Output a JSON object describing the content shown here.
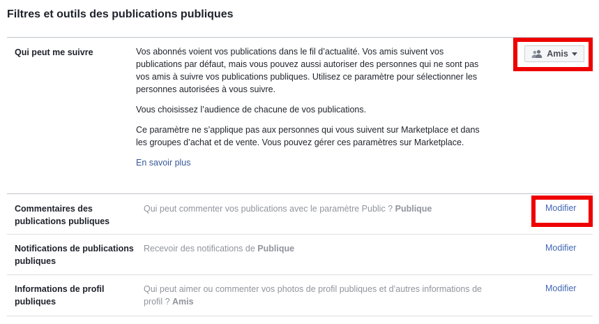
{
  "title": "Filtres et outils des publications publiques",
  "follow": {
    "label": "Qui peut me suivre",
    "paragraph1": "Vos abonnés voient vos publications dans le fil d’actualité. Vos amis suivent vos publications par défaut, mais vous pouvez aussi autoriser des personnes qui ne sont pas vos amis à suivre vos publications publiques. Utilisez ce paramètre pour sélectionner les personnes autorisées à vous suivre.",
    "paragraph2": "Vous choisissez l’audience de chacune de vos publications.",
    "paragraph3": "Ce paramètre ne s’applique pas aux personnes qui vous suivent sur Marketplace et dans les groupes d’achat et de vente. Vous pouvez gérer ces paramètres sur Marketplace.",
    "learn_more": "En savoir plus",
    "audience_button": "Amis",
    "audience_icon": "friends-icon"
  },
  "rows": [
    {
      "label_line1": "Commentaires des",
      "label_line2": "publications publiques",
      "desc_prefix": "Qui peut commenter vos publications avec le paramètre Public ?",
      "desc_value": "Publique",
      "action": "Modifier"
    },
    {
      "label_line1": "Notifications de publications",
      "label_line2": "publiques",
      "desc_prefix": "Recevoir des notifications de",
      "desc_value": "Publique",
      "action": "Modifier"
    },
    {
      "label_line1": "Informations de profil",
      "label_line2": "publiques",
      "desc_prefix": "Qui peut aimer ou commenter vos photos de profil publiques et d’autres informations de profil ?",
      "desc_value": "Amis",
      "action": "Modifier"
    }
  ],
  "colors": {
    "highlight": "#ee0000",
    "link": "#4267b2",
    "muted": "#90949c"
  }
}
